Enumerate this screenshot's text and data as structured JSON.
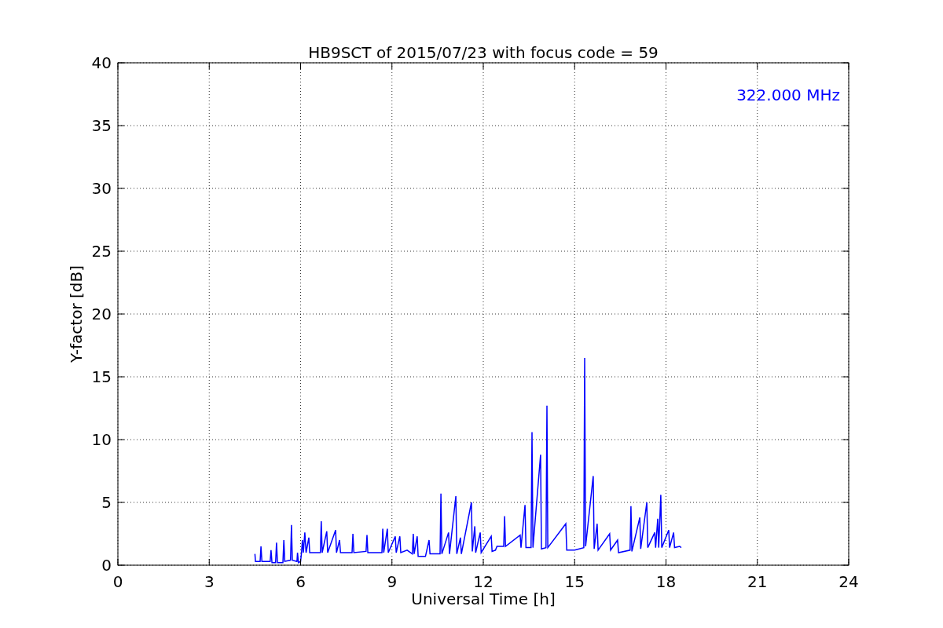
{
  "chart_data": {
    "type": "line",
    "title": "HB9SCT of 2015/07/23 with focus code = 59",
    "xlabel": "Universal Time [h]",
    "ylabel": "Y-factor [dB]",
    "x": [
      4.5,
      4.52,
      4.67,
      4.7,
      4.73,
      5.0,
      5.03,
      5.06,
      5.18,
      5.21,
      5.24,
      5.42,
      5.45,
      5.48,
      5.67,
      5.7,
      5.73,
      5.88,
      5.9,
      5.93,
      6.0,
      6.03,
      6.06,
      6.09,
      6.14,
      6.18,
      6.27,
      6.3,
      6.65,
      6.68,
      6.71,
      6.86,
      6.89,
      7.15,
      7.18,
      7.28,
      7.31,
      7.69,
      7.72,
      7.75,
      8.15,
      8.18,
      8.21,
      8.67,
      8.7,
      8.73,
      8.85,
      8.88,
      9.11,
      9.14,
      9.26,
      9.29,
      9.5,
      9.67,
      9.7,
      9.73,
      9.83,
      9.86,
      10.1,
      10.22,
      10.25,
      10.58,
      10.61,
      10.64,
      10.86,
      10.89,
      11.1,
      11.13,
      11.25,
      11.28,
      11.61,
      11.64,
      11.72,
      11.75,
      11.9,
      11.93,
      12.26,
      12.29,
      12.4,
      12.45,
      12.67,
      12.7,
      12.73,
      13.21,
      13.24,
      13.37,
      13.4,
      13.57,
      13.6,
      13.63,
      13.88,
      13.91,
      14.06,
      14.09,
      14.12,
      14.71,
      14.74,
      15.0,
      15.3,
      15.33,
      15.36,
      15.61,
      15.64,
      15.74,
      15.77,
      16.15,
      16.18,
      16.41,
      16.44,
      16.82,
      16.85,
      16.88,
      17.14,
      17.17,
      17.37,
      17.4,
      17.63,
      17.66,
      17.73,
      17.76,
      17.83,
      17.86,
      18.09,
      18.12,
      18.25,
      18.28,
      18.45,
      18.5
    ],
    "series": [
      {
        "color": "#0000ff",
        "values": [
          0.9,
          0.3,
          0.3,
          1.5,
          0.3,
          0.3,
          1.2,
          0.2,
          0.2,
          1.8,
          0.2,
          0.2,
          2.0,
          0.3,
          0.4,
          3.2,
          0.4,
          0.3,
          1.0,
          0.2,
          0.3,
          1.0,
          2.0,
          1.0,
          2.6,
          1.0,
          2.2,
          1.0,
          1.0,
          3.5,
          1.0,
          2.7,
          1.0,
          2.8,
          1.0,
          2.0,
          1.0,
          1.0,
          2.5,
          1.0,
          1.1,
          2.4,
          1.0,
          1.0,
          2.9,
          1.0,
          2.9,
          1.0,
          2.3,
          1.0,
          2.3,
          1.0,
          1.2,
          0.9,
          2.5,
          0.9,
          2.3,
          0.7,
          0.7,
          2.0,
          0.9,
          0.9,
          5.7,
          0.9,
          2.6,
          0.9,
          5.5,
          0.9,
          2.2,
          0.9,
          5.0,
          1.1,
          3.1,
          1.0,
          2.6,
          1.0,
          2.3,
          1.1,
          1.2,
          1.5,
          1.5,
          3.9,
          1.5,
          2.4,
          1.4,
          4.8,
          1.4,
          1.4,
          10.6,
          1.4,
          8.8,
          1.3,
          1.4,
          12.7,
          1.4,
          3.3,
          1.2,
          1.2,
          1.4,
          16.5,
          1.5,
          7.1,
          1.3,
          3.3,
          1.2,
          2.5,
          1.2,
          2.0,
          1.0,
          1.2,
          4.7,
          1.1,
          3.8,
          1.3,
          5.0,
          1.4,
          2.6,
          1.4,
          3.7,
          1.4,
          5.6,
          1.4,
          2.8,
          1.4,
          2.6,
          1.4,
          1.5,
          1.4
        ]
      }
    ],
    "xlim": [
      0,
      24
    ],
    "ylim": [
      0,
      40
    ],
    "xticks": [
      0,
      3,
      6,
      9,
      12,
      15,
      18,
      21,
      24
    ],
    "yticks": [
      0,
      5,
      10,
      15,
      20,
      25,
      30,
      35,
      40
    ],
    "grid": true,
    "annotations": [
      {
        "text": "322.000 MHz"
      }
    ]
  }
}
